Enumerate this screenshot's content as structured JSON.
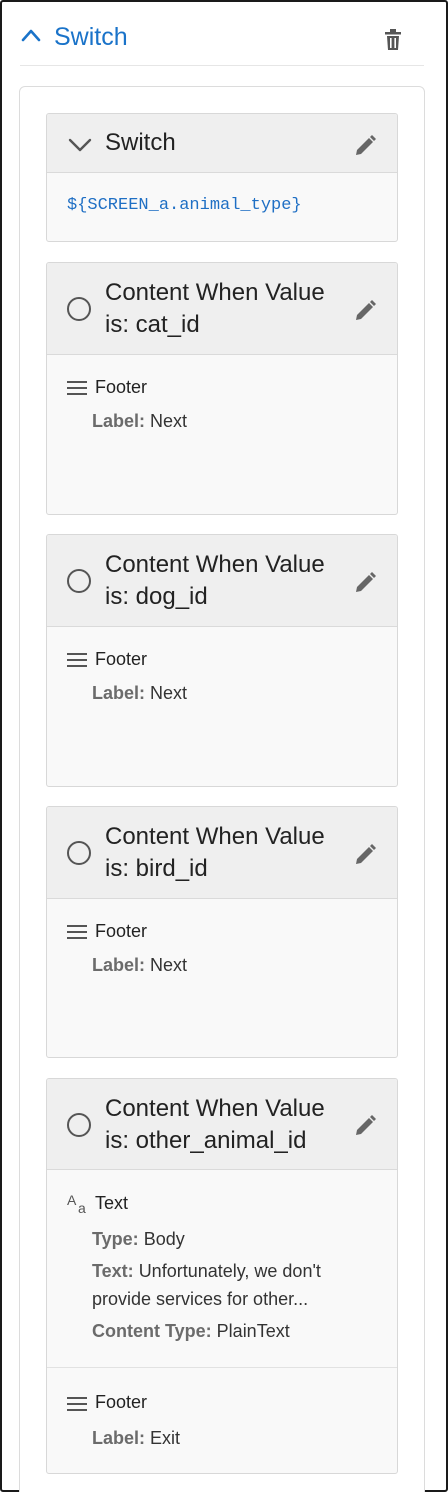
{
  "header": {
    "title": "Switch"
  },
  "switch_card": {
    "title": "Switch",
    "expression": "${SCREEN_a.animal_type}"
  },
  "labels": {
    "label": "Label:",
    "type": "Type:",
    "text": "Text:",
    "content_type": "Content Type:"
  },
  "cases": [
    {
      "title_line1": "Content When Value",
      "title_line2": "is: cat_id",
      "footer_title": "Footer",
      "footer_label": "Next"
    },
    {
      "title_line1": "Content When Value",
      "title_line2": "is: dog_id",
      "footer_title": "Footer",
      "footer_label": "Next"
    },
    {
      "title_line1": "Content When Value",
      "title_line2": "is: bird_id",
      "footer_title": "Footer",
      "footer_label": "Next"
    },
    {
      "title_line1": "Content When Value",
      "title_line2": "is: other_animal_id",
      "text_item": {
        "title": "Text",
        "type": "Body",
        "text_line1": "Unfortunately, we don't",
        "text_line2": "provide services for other...",
        "content_type": "PlainText"
      },
      "footer_title": "Footer",
      "footer_label": "Exit"
    }
  ],
  "colors": {
    "accent": "#1a73c9",
    "code": "#1f6fc4",
    "header_bg": "#efefef"
  }
}
